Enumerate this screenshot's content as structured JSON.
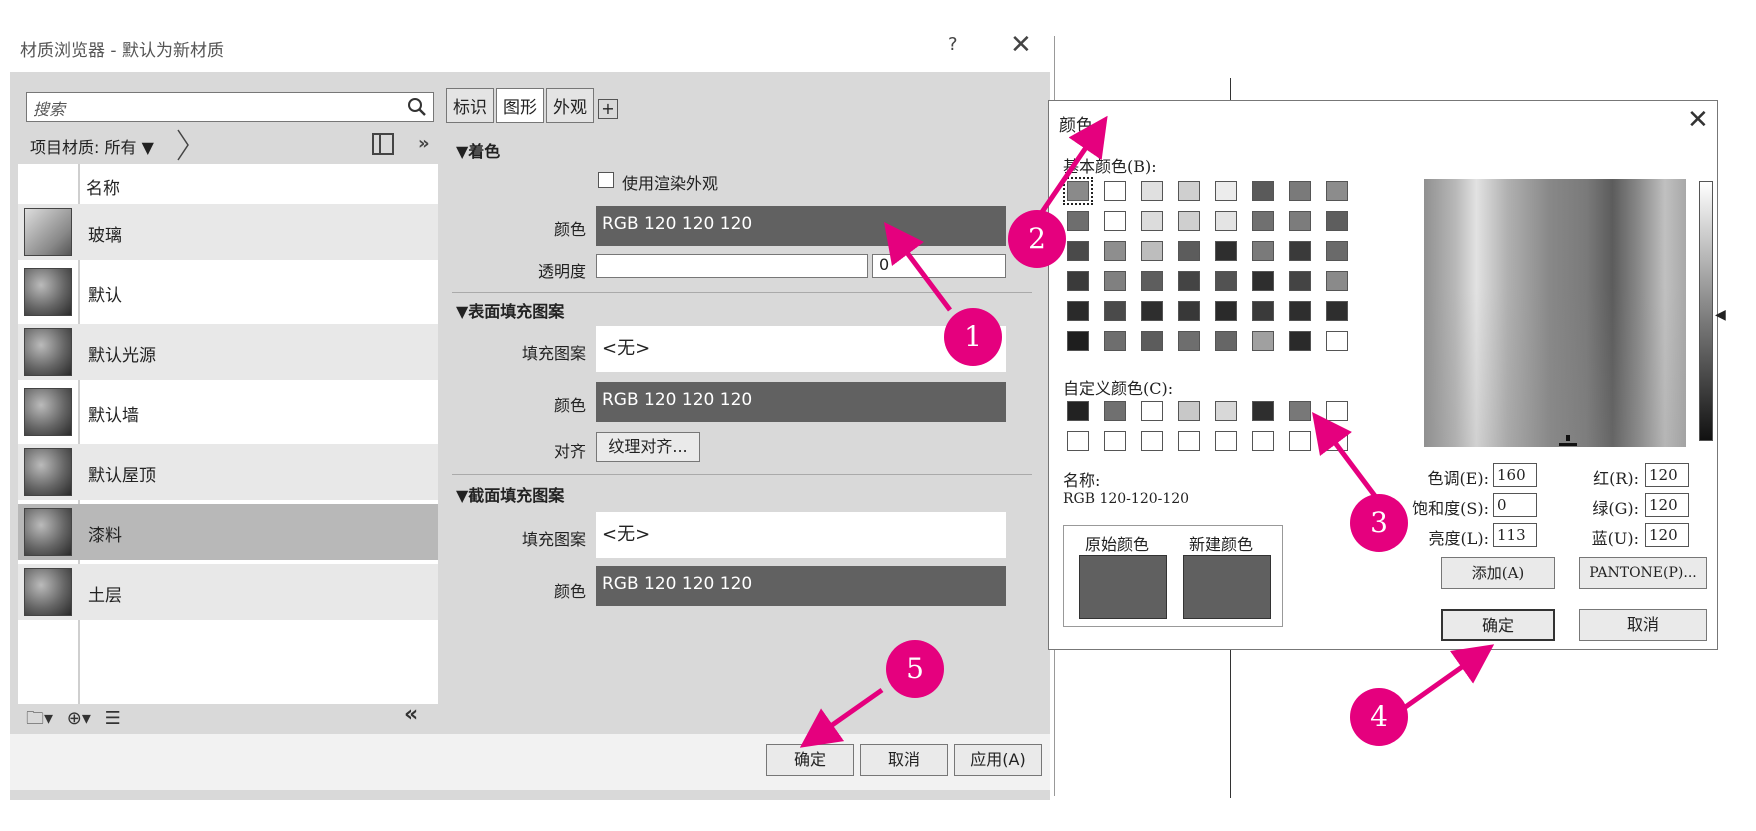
{
  "material_browser": {
    "title": "材质浏览器 - 默认为新材质",
    "help": "?",
    "close": "✕",
    "search": {
      "placeholder": "搜索"
    },
    "filter_label": "项目材质: 所有 ▼",
    "expand_label": "»",
    "list_header": "名称",
    "materials": [
      {
        "name": "玻璃",
        "selected": false
      },
      {
        "name": "默认",
        "selected": false
      },
      {
        "name": "默认光源",
        "selected": false
      },
      {
        "name": "默认墙",
        "selected": false
      },
      {
        "name": "默认屋顶",
        "selected": false
      },
      {
        "name": "漆料",
        "selected": true
      },
      {
        "name": "土层",
        "selected": false
      }
    ],
    "collapse_label": "«",
    "tabs": [
      {
        "label": "标识",
        "active": false
      },
      {
        "label": "图形",
        "active": true
      },
      {
        "label": "外观",
        "active": false
      }
    ],
    "tab_add": "+",
    "shading": {
      "heading": "▼着色",
      "use_render_appearance": "使用渲染外观",
      "color_label": "颜色",
      "color_value": "RGB 120 120 120",
      "transparency_label": "透明度",
      "transparency_value": "0"
    },
    "surface_pattern": {
      "heading": "▼表面填充图案",
      "pattern_label": "填充图案",
      "pattern_value": "<无>",
      "color_label": "颜色",
      "color_value": "RGB 120 120 120",
      "align_label": "对齐",
      "align_button": "纹理对齐..."
    },
    "cut_pattern": {
      "heading": "▼截面填充图案",
      "pattern_label": "填充图案",
      "pattern_value": "<无>",
      "color_label": "颜色",
      "color_value": "RGB 120 120 120"
    },
    "buttons": {
      "ok": "确定",
      "cancel": "取消",
      "apply": "应用(A)"
    }
  },
  "color_dialog": {
    "title": "颜色",
    "close": "✕",
    "basic_colors_label": "基本颜色(B):",
    "basic_colors": [
      [
        "#8a8a8a",
        "#ffffff",
        "#e0e0e0",
        "#cfcfcf",
        "#ececec",
        "#5a5a5a",
        "#7a7a7a",
        "#8c8c8c"
      ],
      [
        "#6e6e6e",
        "#ffffff",
        "#dcdcdc",
        "#cfcfcf",
        "#e4e4e4",
        "#707070",
        "#7c7c7c",
        "#5e5e5e"
      ],
      [
        "#4a4a4a",
        "#8e8e8e",
        "#bdbdbd",
        "#5c5c5c",
        "#2e2e2e",
        "#7a7a7a",
        "#3a3a3a",
        "#6a6a6a"
      ],
      [
        "#3a3a3a",
        "#808080",
        "#5e5e5e",
        "#444444",
        "#525252",
        "#2e2e2e",
        "#444444",
        "#8a8a8a"
      ],
      [
        "#2a2a2a",
        "#4a4a4a",
        "#2e2e2e",
        "#383838",
        "#2a2a2a",
        "#3a3a3a",
        "#2e2e2e",
        "#2e2e2e"
      ],
      [
        "#1e1e1e",
        "#6e6e6e",
        "#5c5c5c",
        "#6e6e6e",
        "#666666",
        "#a0a0a0",
        "#2a2a2a",
        "#ffffff"
      ]
    ],
    "custom_colors_label": "自定义颜色(C):",
    "custom_colors": [
      [
        "#222222",
        "#707070",
        "#ffffff",
        "#c8c8c8",
        "#d8d8d8",
        "#2e2e2e",
        "#787878",
        "#ffffff"
      ],
      [
        "#ffffff",
        "#ffffff",
        "#ffffff",
        "#ffffff",
        "#ffffff",
        "#ffffff",
        "#ffffff",
        "#ffffff"
      ]
    ],
    "name_label": "名称:",
    "name_value": "RGB 120-120-120",
    "original_label": "原始颜色",
    "new_label": "新建颜色",
    "original_color": "#606060",
    "new_color": "#606060",
    "hue_label": "色调(E):",
    "hue": "160",
    "sat_label": "饱和度(S):",
    "sat": "0",
    "lum_label": "亮度(L):",
    "lum": "113",
    "red_label": "红(R):",
    "red": "120",
    "green_label": "绿(G):",
    "green": "120",
    "blue_label": "蓝(U):",
    "blue": "120",
    "add_button": "添加(A)",
    "pantone_button": "PANTONE(P)...",
    "ok_button": "确定",
    "cancel_button": "取消"
  },
  "callouts": [
    "1",
    "2",
    "3",
    "4",
    "5"
  ],
  "accent_color": "#e5007e",
  "panel_color": "#616161"
}
